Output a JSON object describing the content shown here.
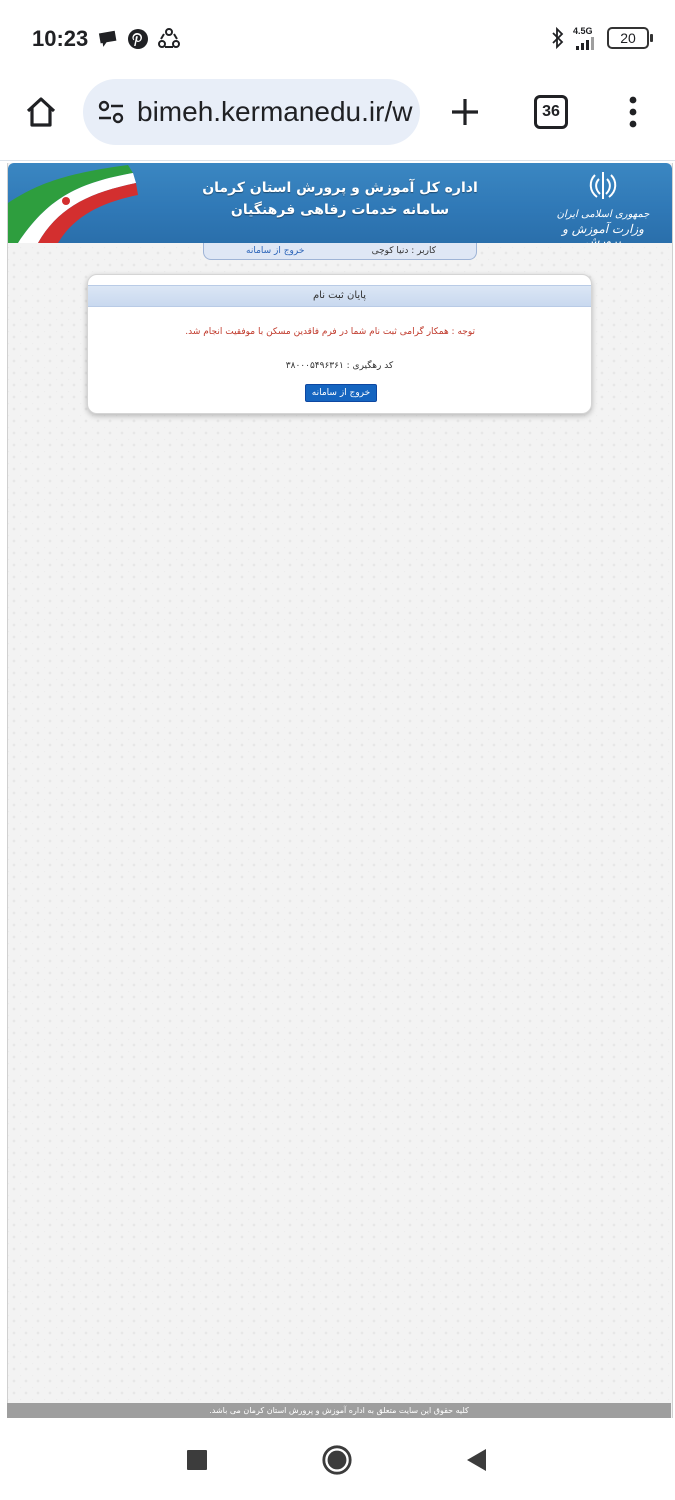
{
  "status_bar": {
    "time": "10:23",
    "network": "4.5G",
    "battery": "20",
    "left_icons": [
      "chat-bubble-icon",
      "pinterest-icon",
      "sync-icon"
    ],
    "right_icons": [
      "bluetooth-icon",
      "signal-icon",
      "battery-icon"
    ]
  },
  "browser": {
    "url": "bimeh.kermanedu.ir/w",
    "tab_count": "36",
    "icons": [
      "home-icon",
      "site-settings-icon",
      "new-tab-icon",
      "tab-switcher-icon",
      "menu-icon"
    ]
  },
  "site": {
    "header_line1": "اداره کل آموزش و پرورش استان کرمان",
    "header_line2": "سامانه خدمات رفاهی فرهنگیان",
    "emblem_line1": "جمهوری اسلامی ایران",
    "emblem_line2": "وزارت آموزش و پرورش",
    "user_label": "کاربر : دنیا کوچی",
    "logout_link": "خروج از سامانه",
    "card_title": "پایان ثبت نام",
    "notice": "توجه : همکار گرامی ثبت نام شما در فرم فاقدین مسکن با موفقیت انجام شد.",
    "tracking_code": "کد رهگیری : ۳۸۰۰۰۵۴۹۶۳۶۱",
    "exit_button": "خروج از سامانه",
    "footer": "کلیه حقوق این سایت متعلق به اداره آموزش و پرورش استان کرمان می باشد."
  },
  "colors": {
    "banner": "#2f78b6",
    "notice_text": "#c0392b",
    "button": "#1565c0",
    "footer": "#9e9e9e"
  },
  "nav": {
    "icons": [
      "recents-square-icon",
      "home-circle-icon",
      "back-triangle-icon"
    ]
  }
}
